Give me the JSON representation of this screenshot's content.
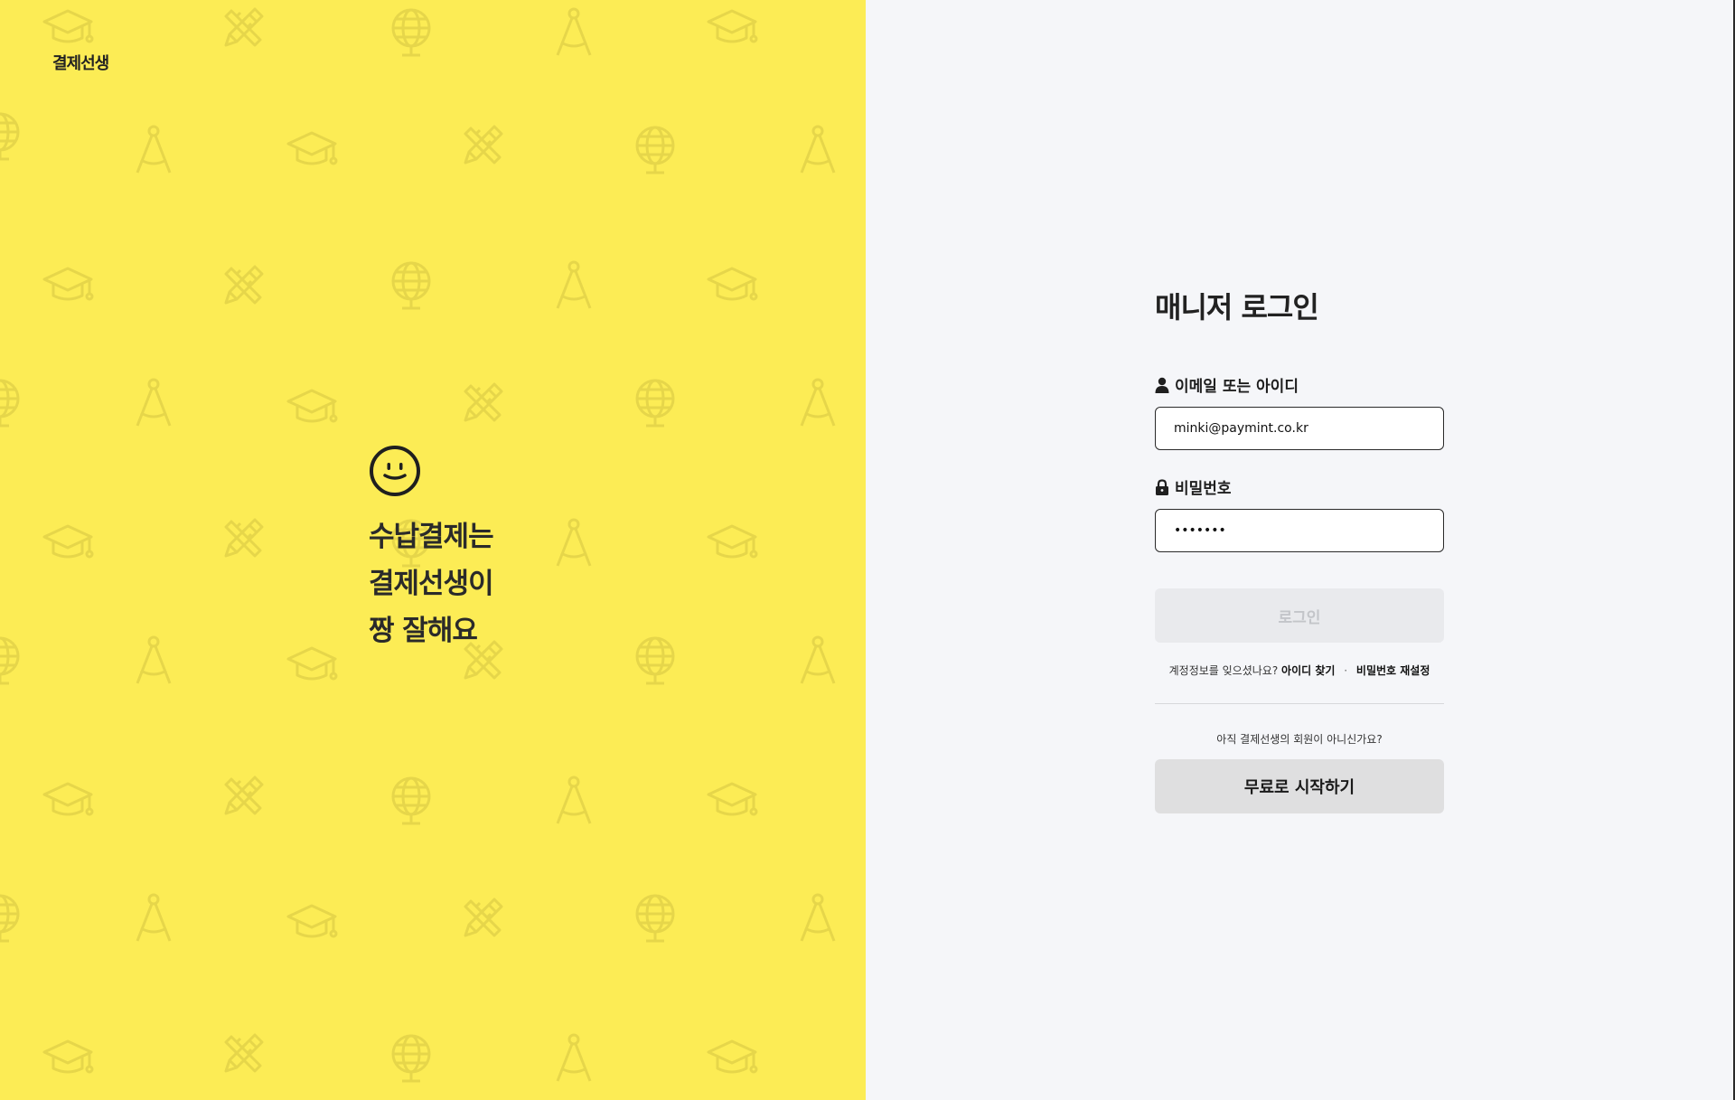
{
  "brand": {
    "logo_text": "결제선생",
    "background_color": "#fcec55",
    "pattern_color": "#e8d94c"
  },
  "hero": {
    "icon": "smiley-icon",
    "lines": [
      "수납결제는",
      "결제선생이",
      "짱 잘해요"
    ]
  },
  "login": {
    "title": "매니저 로그인",
    "email_label": "이메일 또는 아이디",
    "email_icon": "user-icon",
    "email_value": "minki@paymint.co.kr",
    "password_label": "비밀번호",
    "password_icon": "lock-icon",
    "password_value": "•••••••",
    "login_button": "로그인",
    "forgot_prompt": "계정정보를 잊으셨나요?",
    "find_id_link": "아이디 찾기",
    "separator": "·",
    "reset_password_link": "비밀번호 재설정",
    "not_member_text": "아직 결제선생의 회원이 아니신가요?",
    "start_button": "무료로 시작하기"
  }
}
